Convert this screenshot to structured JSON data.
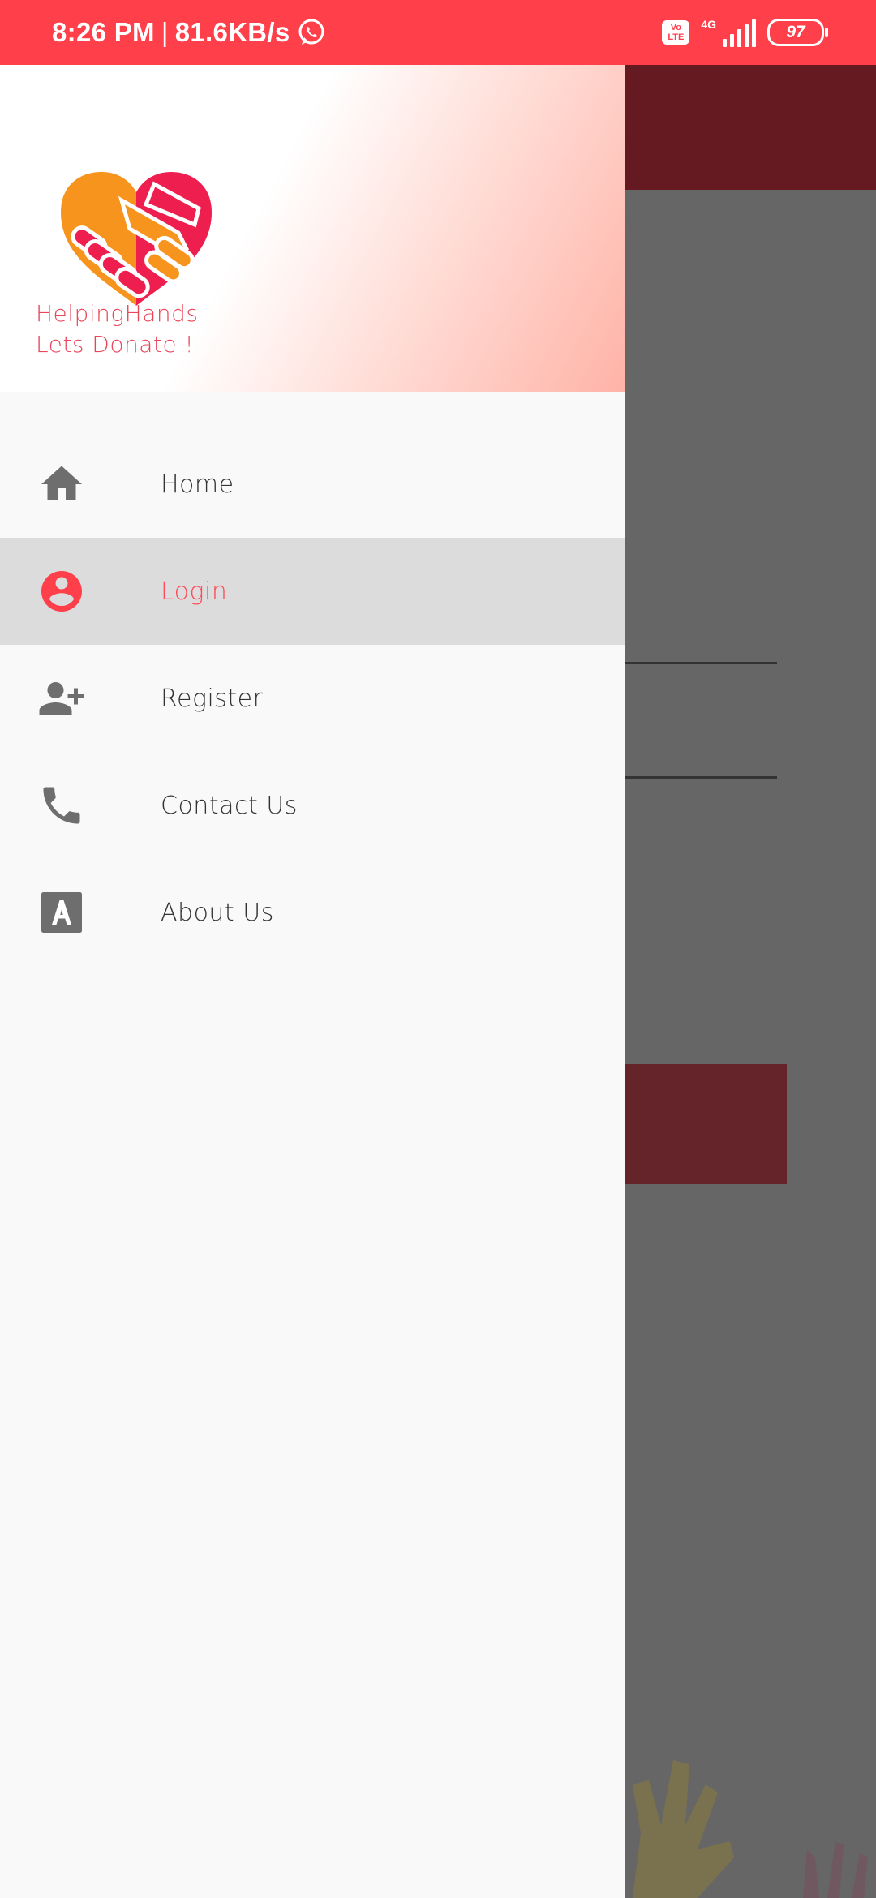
{
  "status_bar": {
    "time": "8:26 PM",
    "separator": "|",
    "speed": "81.6KB/s",
    "volte_top": "Vo",
    "volte_bottom": "LTE",
    "network": "4G",
    "battery": "97"
  },
  "drawer": {
    "brand_line1": "HelpingHands",
    "brand_line2": "Lets Donate !",
    "items": [
      {
        "label": "Home",
        "icon": "home-icon",
        "active": false
      },
      {
        "label": "Login",
        "icon": "account-circle-icon",
        "active": true
      },
      {
        "label": "Register",
        "icon": "person-add-icon",
        "active": false
      },
      {
        "label": "Contact Us",
        "icon": "phone-icon",
        "active": false
      },
      {
        "label": "About Us",
        "icon": "letter-a-icon",
        "active": false
      }
    ]
  },
  "colors": {
    "accent": "#ff3f4a",
    "active_item_bg": "#dcdcdc",
    "icon_gray": "#6e6e6e",
    "brand_text": "#e9465a"
  }
}
